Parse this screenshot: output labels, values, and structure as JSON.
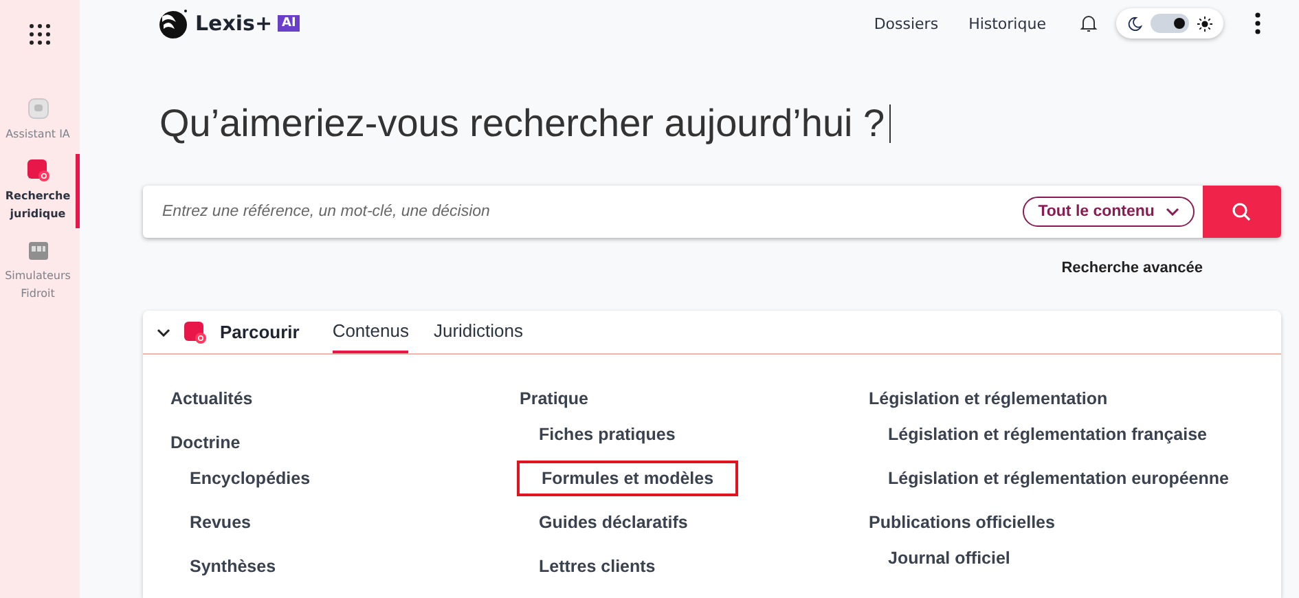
{
  "sidebar": {
    "items": [
      {
        "label": "Assistant IA",
        "kind": "chat",
        "selected": false
      },
      {
        "label": "Recherche juridique",
        "kind": "search",
        "selected": true
      },
      {
        "label": "Simulateurs Fidroit",
        "kind": "sim",
        "selected": false
      }
    ]
  },
  "header": {
    "logo": "Lexis+",
    "logo_badge": "AI",
    "links": [
      "Dossiers",
      "Historique"
    ],
    "theme_toggle": {
      "on": true
    }
  },
  "headline": "Qu’aimeriez-vous rechercher aujourd’hui ?",
  "search": {
    "placeholder": "Entrez une référence, un mot-clé, une décision",
    "scope": "Tout le contenu",
    "advanced": "Recherche avancée"
  },
  "browse": {
    "title": "Parcourir",
    "expanded": true,
    "tabs": [
      {
        "label": "Contenus",
        "selected": true
      },
      {
        "label": "Juridictions",
        "selected": false
      }
    ],
    "columns": [
      [
        {
          "label": "Actualités",
          "highlighted": false
        },
        {
          "label": "Doctrine",
          "highlighted": false,
          "children": [
            {
              "label": "Encyclopédies",
              "highlighted": false
            },
            {
              "label": "Revues",
              "highlighted": false
            },
            {
              "label": "Synthèses",
              "highlighted": false
            }
          ]
        }
      ],
      [
        {
          "label": "Pratique",
          "highlighted": false,
          "children": [
            {
              "label": "Fiches pratiques",
              "highlighted": false
            },
            {
              "label": "Formules et modèles",
              "highlighted": true
            },
            {
              "label": "Guides déclaratifs",
              "highlighted": false
            },
            {
              "label": "Lettres clients",
              "highlighted": false
            }
          ]
        }
      ],
      [
        {
          "label": "Législation et réglementation",
          "highlighted": false,
          "children": [
            {
              "label": "Législation et réglementation française",
              "highlighted": false
            },
            {
              "label": "Législation et réglementation européenne",
              "highlighted": false
            }
          ]
        },
        {
          "label": "Publications officielles",
          "highlighted": false,
          "children": [
            {
              "label": "Journal officiel",
              "highlighted": false
            }
          ]
        }
      ]
    ]
  }
}
